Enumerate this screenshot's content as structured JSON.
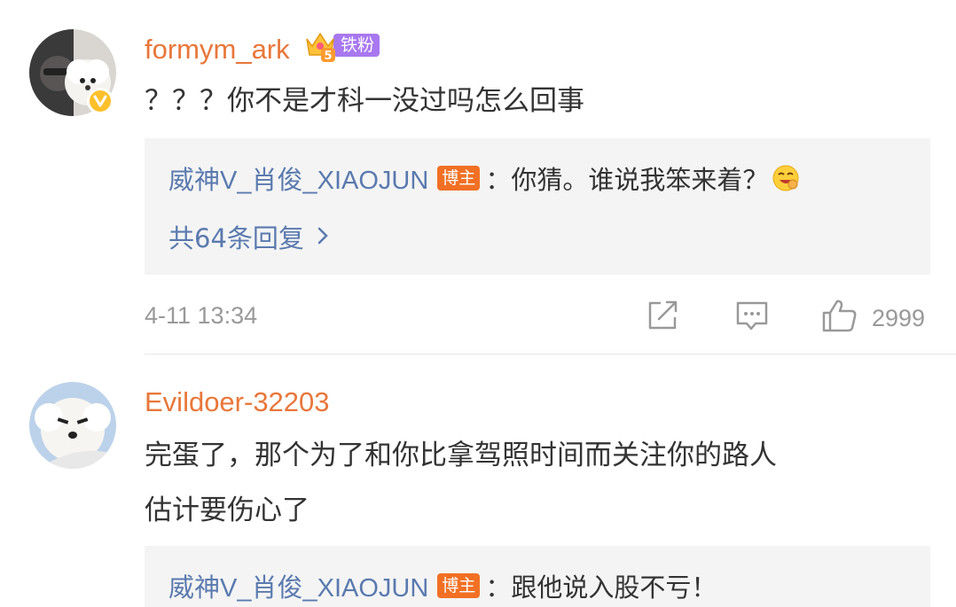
{
  "comments": [
    {
      "username": "formym_ark",
      "fan_badge": {
        "level": "5",
        "label": "铁粉"
      },
      "verified": true,
      "text": "？？？你不是才科一没过吗怎么回事",
      "reply": {
        "user": "威神V_肖俊_XIAOJUN",
        "tag": "博主",
        "text": "：你猜。谁说我笨来着？",
        "emoji": "laughing-face-emoji"
      },
      "more_replies": "共64条回复",
      "time": "4-11 13:34",
      "like_count": "2999"
    },
    {
      "username": "Evildoer-32203",
      "text_lines": [
        "完蛋了，那个为了和你比拿驾照时间而关注你的路人",
        "估计要伤心了"
      ],
      "reply": {
        "user": "威神V_肖俊_XIAOJUN",
        "tag": "博主",
        "text": "：跟他说入股不亏！"
      }
    }
  ],
  "icons": {
    "share": "share-icon",
    "comment": "comment-icon",
    "like": "thumbs-up-icon",
    "chevron": "chevron-right-icon"
  },
  "colors": {
    "username": "#e8773a",
    "reply_user": "#5a7aaf",
    "host_tag": "#f17024",
    "fan_badge": "#a878f0",
    "reply_bg": "#f4f4f4",
    "meta": "#999999"
  }
}
